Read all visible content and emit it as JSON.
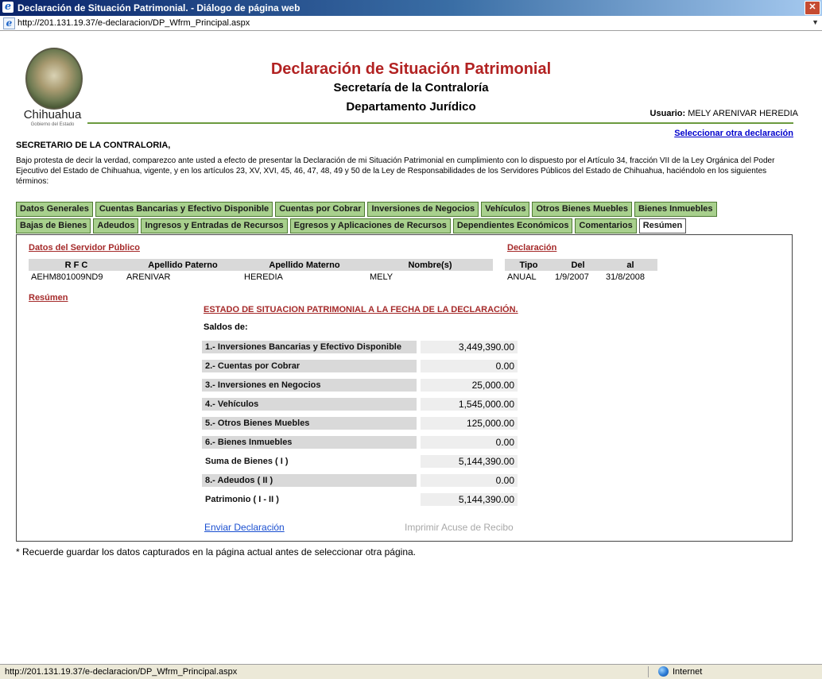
{
  "window": {
    "title": "Declaración de Situación Patrimonial. - Diálogo de página web",
    "close_glyph": "✕"
  },
  "address": {
    "url": "http://201.131.19.37/e-declaracion/DP_Wfrm_Principal.aspx"
  },
  "logo": {
    "text": "Chihuahua",
    "subtext": "Gobierno del Estado"
  },
  "header": {
    "title": "Declaración de Situación Patrimonial",
    "subtitle1": "Secretaría de la Contraloría",
    "subtitle2": "Departamento Jurídico",
    "usuario_label": "Usuario:",
    "usuario_value": "MELY ARENIVAR HEREDIA",
    "select_other": "Seleccionar otra declaración"
  },
  "protest": {
    "title": "SECRETARIO DE LA CONTRALORIA,",
    "text": "Bajo protesta de decir la verdad, comparezco ante usted a efecto de presentar la Declaración de mi Situación Patrimonial en cumplimiento con lo dispuesto por el Artículo 34, fracción VII de la Ley Orgánica del Poder Ejecutivo del Estado de Chihuahua, vigente, y en los artículos 23, XV, XVI, 45, 46, 47, 48, 49 y 50 de la Ley de Responsabilidades de los Servidores Públicos del Estado de Chihuahua, haciéndolo en los siguientes términos:"
  },
  "tabs": {
    "row1": [
      "Datos Generales",
      "Cuentas Bancarias y Efectivo Disponible",
      "Cuentas por Cobrar",
      "Inversiones de Negocios",
      "Vehículos",
      "Otros Bienes Muebles",
      "Bienes Inmuebles"
    ],
    "row2": [
      "Bajas de Bienes",
      "Adeudos",
      "Ingresos y Entradas de Recursos",
      "Egresos y Aplicaciones de Recursos",
      "Dependientes Económicos",
      "Comentarios",
      "Resúmen"
    ]
  },
  "servidor": {
    "section_label": "Datos del Servidor Público",
    "headers": [
      "R F C",
      "Apellido Paterno",
      "Apellido Materno",
      "Nombre(s)"
    ],
    "values": [
      "AEHM801009ND9",
      "ARENIVAR",
      "HEREDIA",
      "MELY"
    ]
  },
  "declaracion": {
    "section_label": "Declaración",
    "headers": [
      "Tipo",
      "Del",
      "al"
    ],
    "values": [
      "ANUAL",
      "1/9/2007",
      "31/8/2008"
    ]
  },
  "resumen": {
    "section_label": "Resúmen",
    "title": "ESTADO DE SITUACION PATRIMONIAL A LA FECHA DE LA DECLARACIÓN.",
    "saldos_label": "Saldos de:",
    "rows": [
      {
        "label": "1.- Inversiones Bancarias y Efectivo Disponible",
        "value": "3,449,390.00"
      },
      {
        "label": "2.- Cuentas por Cobrar",
        "value": "0.00"
      },
      {
        "label": "3.- Inversiones en Negocios",
        "value": "25,000.00"
      },
      {
        "label": "4.- Vehículos",
        "value": "1,545,000.00"
      },
      {
        "label": "5.- Otros Bienes Muebles",
        "value": "125,000.00"
      },
      {
        "label": "6.- Bienes Inmuebles",
        "value": "0.00"
      },
      {
        "label": "Suma de Bienes ( I )",
        "value": "5,144,390.00"
      },
      {
        "label": "8.- Adeudos ( II )",
        "value": "0.00"
      },
      {
        "label": "Patrimonio ( I - II )",
        "value": "5,144,390.00"
      }
    ],
    "send_label": "Enviar Declaración",
    "print_label": "Imprimir Acuse de Recibo"
  },
  "footnote": "* Recuerde guardar los datos capturados en la página actual antes de seleccionar otra página.",
  "status": {
    "url": "http://201.131.19.37/e-declaracion/DP_Wfrm_Principal.aspx",
    "zone": "Internet"
  }
}
